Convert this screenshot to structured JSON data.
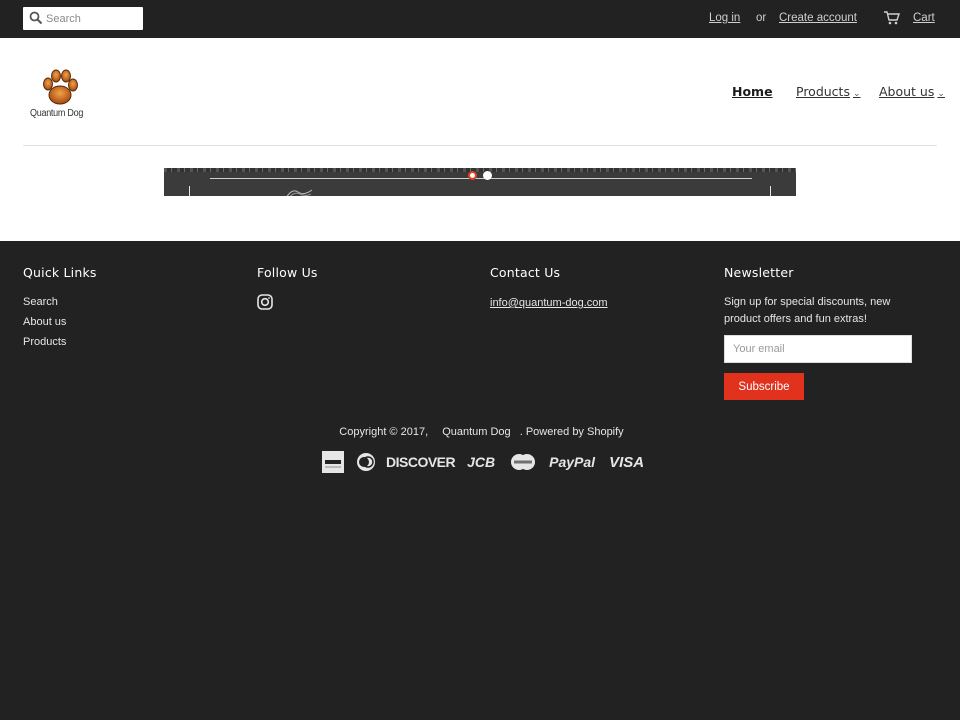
{
  "topbar": {
    "search_placeholder": "Search",
    "login": "Log in",
    "or": "or",
    "create_account": "Create account",
    "cart": "Cart"
  },
  "header": {
    "logo_text": "Quantum Dog",
    "nav": [
      {
        "label": "Home",
        "active": true
      },
      {
        "label": "Products",
        "has_dropdown": true
      },
      {
        "label": "About us",
        "has_dropdown": true
      }
    ]
  },
  "slideshow": {
    "slide_count": 2,
    "active_index": 0
  },
  "footer": {
    "quick_links": {
      "title": "Quick Links",
      "items": [
        "Search",
        "About us",
        "Products"
      ]
    },
    "follow_us": {
      "title": "Follow Us",
      "icon": "instagram-icon"
    },
    "contact": {
      "title": "Contact Us",
      "email": "info@quantum-dog.com"
    },
    "newsletter": {
      "title": "Newsletter",
      "text": "Sign up for special discounts, new product offers and fun extras!",
      "email_placeholder": "Your email",
      "button": "Subscribe"
    },
    "copyright": {
      "prefix": "Copyright © 2017,",
      "shop": "Quantum Dog",
      "powered": ". Powered by Shopify"
    },
    "payment_icons": [
      "american-express-icon",
      "diners-club-icon",
      "discover-icon",
      "jcb-icon",
      "mastercard-icon",
      "paypal-icon",
      "visa-icon"
    ],
    "payment_labels": {
      "discover": "DISCOVER",
      "jcb": "JCB",
      "paypal": "PayPal",
      "visa": "VISA"
    }
  },
  "colors": {
    "dark_bg": "#222222",
    "accent": "#e0321d",
    "white": "#ffffff"
  }
}
